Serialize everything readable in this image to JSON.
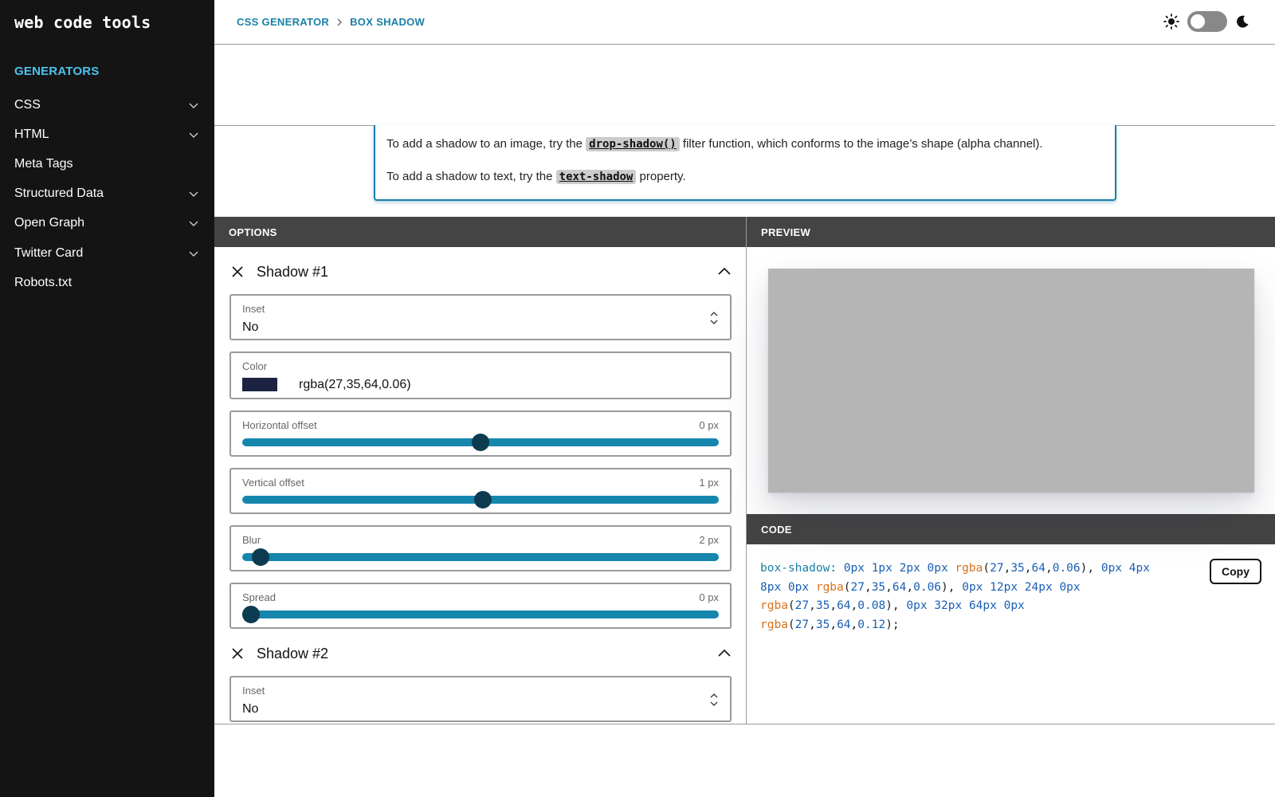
{
  "app": {
    "logo": "web code tools"
  },
  "sidebar": {
    "section_label": "GENERATORS",
    "items": [
      {
        "label": "CSS",
        "expandable": true
      },
      {
        "label": "HTML",
        "expandable": true
      },
      {
        "label": "Meta Tags",
        "expandable": false
      },
      {
        "label": "Structured Data",
        "expandable": true
      },
      {
        "label": "Open Graph",
        "expandable": true
      },
      {
        "label": "Twitter Card",
        "expandable": true
      },
      {
        "label": "Robots.txt",
        "expandable": false
      }
    ]
  },
  "header": {
    "breadcrumb": [
      "CSS GENERATOR",
      "BOX SHADOW"
    ],
    "breadcrumb_separator": ">",
    "theme_toggle": {
      "left_icon": "sun-icon",
      "right_icon": "moon-icon",
      "dark_mode": false
    }
  },
  "info": {
    "line1_before": "To add a shadow to an image, try the",
    "line1_code": "drop-shadow()",
    "line1_after": "filter function, which conforms to the image’s shape (alpha channel).",
    "line2_before": "To add a shadow to text, try the",
    "line2_code": "text-shadow",
    "line2_after": "property."
  },
  "options": {
    "title": "OPTIONS",
    "shadows": [
      {
        "title": "Shadow #1",
        "inset": {
          "label": "Inset",
          "value": "No"
        },
        "color": {
          "label": "Color",
          "value": "rgba(27,35,64,0.06)",
          "swatch": "#1b2340"
        },
        "sliders": [
          {
            "label": "Horizontal offset",
            "display": "0 px",
            "fraction": 0.5
          },
          {
            "label": "Vertical offset",
            "display": "1 px",
            "fraction": 0.506
          },
          {
            "label": "Blur",
            "display": "2 px",
            "fraction": 0.02
          },
          {
            "label": "Spread",
            "display": "0 px",
            "fraction": 0.0
          }
        ]
      },
      {
        "title": "Shadow #2",
        "inset": {
          "label": "Inset",
          "value": "No"
        }
      }
    ]
  },
  "preview": {
    "title": "PREVIEW"
  },
  "code": {
    "title": "CODE",
    "lines": [
      "box-shadow: 0px 1px 2px 0px rgba(27,35,64,0.06), 0px 4px",
      "8px 0px rgba(27,35,64,0.06), 0px 12px 24px 0px",
      "rgba(27,35,64,0.08), 0px 32px 64px 0px",
      "rgba(27,35,64,0.12);"
    ],
    "copy_label": "Copy"
  },
  "colors": {
    "accent": "#1a7fa6",
    "slider_track": "#1686ad",
    "slider_thumb": "#0d3b4f",
    "sidebar_bg": "#141414",
    "generators_label": "#4cc3f0"
  }
}
